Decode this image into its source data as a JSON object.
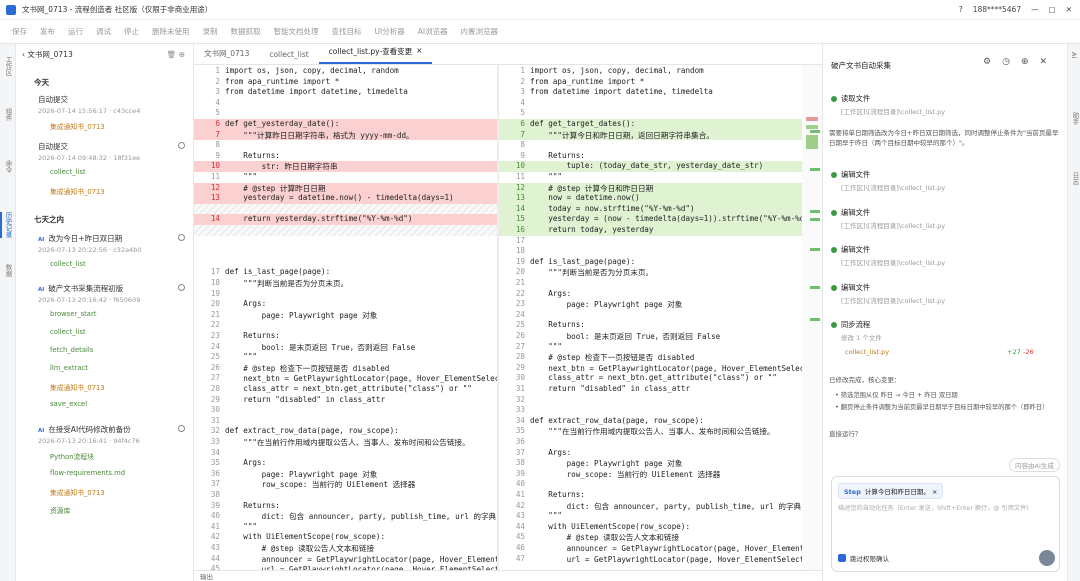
{
  "titlebar": {
    "title": "文书网_0713 - 流程创造者 社区版（仅限于非商业用途）",
    "user": "188****5467"
  },
  "toolbar": [
    "保存",
    "发布",
    "运行",
    "调试",
    "停止",
    "删除未使用",
    "录制",
    "数据抓取",
    "智能文档处理",
    "查找目标",
    "UI分析器",
    "AI浏览器",
    "内置浏览器"
  ],
  "leftstrip": [
    "工作区",
    "组件",
    "命令",
    "历史记录",
    "数据"
  ],
  "rightstrip": [
    "AI",
    "助手",
    "日志"
  ],
  "history": {
    "project": "文书网_0713",
    "today": "今天",
    "week": "七天之内",
    "items": [
      {
        "title": "自动提交",
        "meta": "2026-07-14 15:56:17 · c43cce4",
        "subs": [
          "集成通知书_0713"
        ]
      },
      {
        "title": "自动提交",
        "meta": "2026-07-14 09:48:32 · 18f31ee",
        "subs": [
          "collect_list",
          "集成通知书_0713"
        ]
      },
      {
        "title": "改为今日+昨日双日期",
        "meta": "2026-07-13 20:22:56 · c32a4b0",
        "subs": [
          "collect_list"
        ]
      },
      {
        "title": "破产文书采集流程初版",
        "meta": "2026-07-13 20:16:42 · f650609",
        "subs": [
          "browser_start",
          "collect_list",
          "fetch_details",
          "llm_extract",
          "集成通知书_0713",
          "save_excel"
        ]
      },
      {
        "title": "在接受AI代码修改前备份",
        "meta": "2026-07-13 20:16:41 · 94f4c76",
        "subs": [
          "Python流程块",
          "flow-requirements.md",
          "集成通知书_0713",
          "资源库"
        ]
      }
    ]
  },
  "tabs": [
    "文书网_0713",
    "collect_list",
    "collect_list.py-查看变更"
  ],
  "editor_footer": "输出",
  "left_code": [
    {
      "n": "1",
      "t": "import os, json, copy, decimal, random",
      "s": ""
    },
    {
      "n": "2",
      "t": "from apa_runtime import *",
      "s": ""
    },
    {
      "n": "3",
      "t": "from datetime import datetime, timedelta",
      "s": ""
    },
    {
      "n": "4",
      "t": "",
      "s": ""
    },
    {
      "n": "5",
      "t": "",
      "s": ""
    },
    {
      "n": "6",
      "t": "def get_yesterday_date():",
      "s": "del"
    },
    {
      "n": "7",
      "t": "    \"\"\"计算昨日日期字符串，格式为 yyyy-mm-dd。",
      "s": "del"
    },
    {
      "n": "8",
      "t": "",
      "s": ""
    },
    {
      "n": "9",
      "t": "    Returns:",
      "s": ""
    },
    {
      "n": "10",
      "t": "        str: 昨日日期字符串",
      "s": "del"
    },
    {
      "n": "11",
      "t": "    \"\"\"",
      "s": ""
    },
    {
      "n": "12",
      "t": "    # @step 计算昨日日期",
      "s": "del"
    },
    {
      "n": "13",
      "t": "    yesterday = datetime.now() - timedelta(days=1)",
      "s": "del"
    },
    {
      "n": "",
      "t": "",
      "s": "hatch"
    },
    {
      "n": "14",
      "t": "    return yesterday.strftime(\"%Y-%m-%d\")",
      "s": "del"
    },
    {
      "n": "",
      "t": "",
      "s": "hatch"
    },
    {
      "n": "",
      "t": "",
      "s": ""
    },
    {
      "n": "",
      "t": "",
      "s": ""
    },
    {
      "n": "",
      "t": "",
      "s": ""
    },
    {
      "n": "17",
      "t": "def is_last_page(page):",
      "s": ""
    },
    {
      "n": "18",
      "t": "    \"\"\"判断当前是否为分页末页。",
      "s": ""
    },
    {
      "n": "19",
      "t": "",
      "s": ""
    },
    {
      "n": "20",
      "t": "    Args:",
      "s": ""
    },
    {
      "n": "21",
      "t": "        page: Playwright page 对象",
      "s": ""
    },
    {
      "n": "22",
      "t": "",
      "s": ""
    },
    {
      "n": "23",
      "t": "    Returns:",
      "s": ""
    },
    {
      "n": "24",
      "t": "        bool: 是末页返回 True，否则返回 False",
      "s": ""
    },
    {
      "n": "25",
      "t": "    \"\"\"",
      "s": ""
    },
    {
      "n": "26",
      "t": "    # @step 检查下一页按钮是否 disabled",
      "s": ""
    },
    {
      "n": "27",
      "t": "    next_btn = GetPlaywrightLocator(page, Hover_ElementSelect(\"分页下一页按钮\")",
      "s": ""
    },
    {
      "n": "28",
      "t": "    class_attr = next_btn.get_attribute(\"class\") or \"\"",
      "s": ""
    },
    {
      "n": "29",
      "t": "    return \"disabled\" in class_attr",
      "s": ""
    },
    {
      "n": "30",
      "t": "",
      "s": ""
    },
    {
      "n": "31",
      "t": "",
      "s": ""
    },
    {
      "n": "32",
      "t": "def extract_row_data(page, row_scope):",
      "s": ""
    },
    {
      "n": "33",
      "t": "    \"\"\"在当前行作用域内提取公告人、当事人、发布时间和公告链接。",
      "s": ""
    },
    {
      "n": "34",
      "t": "",
      "s": ""
    },
    {
      "n": "35",
      "t": "    Args:",
      "s": ""
    },
    {
      "n": "36",
      "t": "        page: Playwright page 对象",
      "s": ""
    },
    {
      "n": "37",
      "t": "        row_scope: 当前行的 UiElement 选择器",
      "s": ""
    },
    {
      "n": "38",
      "t": "",
      "s": ""
    },
    {
      "n": "39",
      "t": "    Returns:",
      "s": ""
    },
    {
      "n": "40",
      "t": "        dict: 包含 announcer, party, publish_time, url 的字典",
      "s": ""
    },
    {
      "n": "41",
      "t": "    \"\"\"",
      "s": ""
    },
    {
      "n": "42",
      "t": "    with UiElementScope(row_scope):",
      "s": ""
    },
    {
      "n": "43",
      "t": "        # @step 读取公告人文本和链接",
      "s": ""
    },
    {
      "n": "44",
      "t": "        announcer = GetPlaywrightLocator(page, Hover_ElementSelect(\"公告人\")",
      "s": ""
    },
    {
      "n": "45",
      "t": "        url = GetPlaywrightLocator(page, Hover_ElementSelect(\"公告人\")",
      "s": ""
    }
  ],
  "right_code": [
    {
      "n": "1",
      "t": "import os, json, copy, decimal, random",
      "s": ""
    },
    {
      "n": "2",
      "t": "from apa_runtime import *",
      "s": ""
    },
    {
      "n": "3",
      "t": "from datetime import datetime, timedelta",
      "s": ""
    },
    {
      "n": "4",
      "t": "",
      "s": ""
    },
    {
      "n": "5",
      "t": "",
      "s": ""
    },
    {
      "n": "6",
      "t": "def get_target_dates():",
      "s": "add"
    },
    {
      "n": "7",
      "t": "    \"\"\"计算今日和昨日日期，返回日期字符串集合。",
      "s": "add"
    },
    {
      "n": "8",
      "t": "",
      "s": ""
    },
    {
      "n": "9",
      "t": "    Returns:",
      "s": ""
    },
    {
      "n": "10",
      "t": "        tuple: (today_date_str, yesterday_date_str)",
      "s": "add"
    },
    {
      "n": "11",
      "t": "    \"\"\"",
      "s": ""
    },
    {
      "n": "12",
      "t": "    # @step 计算今日和昨日日期",
      "s": "add"
    },
    {
      "n": "13",
      "t": "    now = datetime.now()",
      "s": "add"
    },
    {
      "n": "14",
      "t": "    today = now.strftime(\"%Y-%m-%d\")",
      "s": "add"
    },
    {
      "n": "15",
      "t": "    yesterday = (now - timedelta(days=1)).strftime(\"%Y-%m-%d\")",
      "s": "add"
    },
    {
      "n": "16",
      "t": "    return today, yesterday",
      "s": "add"
    },
    {
      "n": "17",
      "t": "",
      "s": ""
    },
    {
      "n": "18",
      "t": "",
      "s": ""
    },
    {
      "n": "19",
      "t": "def is_last_page(page):",
      "s": ""
    },
    {
      "n": "20",
      "t": "    \"\"\"判断当前是否为分页末页。",
      "s": ""
    },
    {
      "n": "21",
      "t": "",
      "s": ""
    },
    {
      "n": "22",
      "t": "    Args:",
      "s": ""
    },
    {
      "n": "23",
      "t": "        page: Playwright page 对象",
      "s": ""
    },
    {
      "n": "24",
      "t": "",
      "s": ""
    },
    {
      "n": "25",
      "t": "    Returns:",
      "s": ""
    },
    {
      "n": "26",
      "t": "        bool: 是末页返回 True，否则返回 False",
      "s": ""
    },
    {
      "n": "27",
      "t": "    \"\"\"",
      "s": ""
    },
    {
      "n": "28",
      "t": "    # @step 检查下一页按钮是否 disabled",
      "s": ""
    },
    {
      "n": "29",
      "t": "    next_btn = GetPlaywrightLocator(page, Hover_ElementSelect(\"分页下一页按钮\")",
      "s": ""
    },
    {
      "n": "30",
      "t": "    class_attr = next_btn.get_attribute(\"class\") or \"\"",
      "s": ""
    },
    {
      "n": "31",
      "t": "    return \"disabled\" in class_attr",
      "s": ""
    },
    {
      "n": "32",
      "t": "",
      "s": ""
    },
    {
      "n": "33",
      "t": "",
      "s": ""
    },
    {
      "n": "34",
      "t": "def extract_row_data(page, row_scope):",
      "s": ""
    },
    {
      "n": "35",
      "t": "    \"\"\"在当前行作用域内提取公告人、当事人、发布时间和公告链接。",
      "s": ""
    },
    {
      "n": "36",
      "t": "",
      "s": ""
    },
    {
      "n": "37",
      "t": "    Args:",
      "s": ""
    },
    {
      "n": "38",
      "t": "        page: Playwright page 对象",
      "s": ""
    },
    {
      "n": "39",
      "t": "        row_scope: 当前行的 UiElement 选择器",
      "s": ""
    },
    {
      "n": "40",
      "t": "",
      "s": ""
    },
    {
      "n": "41",
      "t": "    Returns:",
      "s": ""
    },
    {
      "n": "42",
      "t": "        dict: 包含 announcer, party, publish_time, url 的字典",
      "s": ""
    },
    {
      "n": "43",
      "t": "    \"\"\"",
      "s": ""
    },
    {
      "n": "44",
      "t": "    with UiElementScope(row_scope):",
      "s": ""
    },
    {
      "n": "45",
      "t": "        # @step 读取公告人文本和链接",
      "s": ""
    },
    {
      "n": "46",
      "t": "        announcer = GetPlaywrightLocator(page, Hover_ElementSelect(\"公告人\")",
      "s": ""
    },
    {
      "n": "47",
      "t": "        url = GetPlaywrightLocator(page, Hover_ElementSelect(\"公告人\")",
      "s": ""
    }
  ],
  "chat": {
    "title": "破产文书自动采集",
    "steps": [
      {
        "label": "读取文件",
        "path": "[工作区]\\[流程目录]\\collect_list.py"
      },
      {
        "label": "编辑文件",
        "path": "[工作区]\\[流程目录]\\collect_list.py"
      },
      {
        "label": "编辑文件",
        "path": "[工作区]\\[流程目录]\\collect_list.py"
      },
      {
        "label": "编辑文件",
        "path": "[工作区]\\[流程目录]\\collect_list.py"
      },
      {
        "label": "编辑文件",
        "path": "[工作区]\\[流程目录]\\collect_list.py"
      }
    ],
    "intro": "需要将单日期筛选改为今日+昨日双日期筛选，同时调整停止条件为\"当前页最早日期早于昨日（两个目标日期中较早的那个）\"。",
    "sync": {
      "label": "同步流程",
      "sub": "修改 1 个文件",
      "file": "collect_list.py",
      "added": "+27",
      "removed": "-26"
    },
    "done": "已修改完成，核心变更：",
    "bullets": [
      "筛选范围从仅 昨日 → 今日 + 昨日 双日期",
      "翻页停止条件调整为当前页最早日期早于目标日期中较早的那个（即昨日）"
    ],
    "question": "直接运行？",
    "ask_btn": "内容由AI生成",
    "chip_step": "Step",
    "chip_text": "计算今日和昨日日期。",
    "placeholder": "描述您的自动化任务（Enter 发送，Shift+Enter 换行，@ 引用文件）",
    "skip": "跳过权限确认"
  }
}
